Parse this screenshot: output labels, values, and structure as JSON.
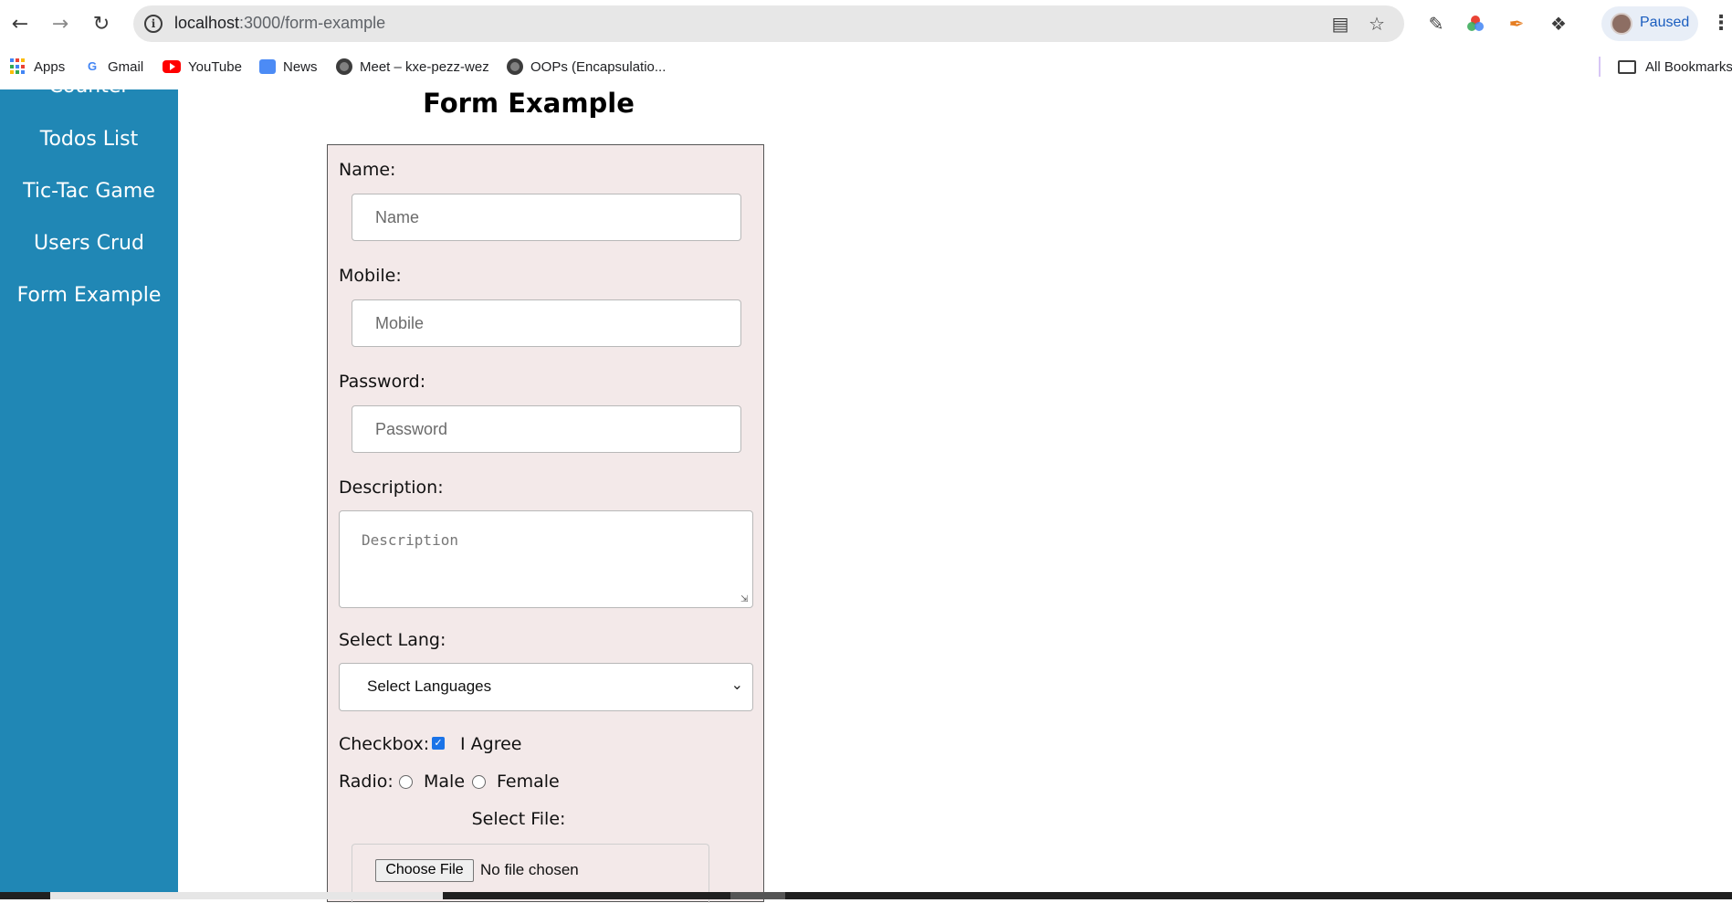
{
  "browser": {
    "url_host": "localhost",
    "url_path": ":3000/form-example",
    "profile_label": "Paused",
    "bookmarks": [
      "Apps",
      "Gmail",
      "YouTube",
      "News",
      "Meet – kxe-pezz-wez",
      "OOPs (Encapsulatio..."
    ],
    "all_bookmarks": "All Bookmarks",
    "gmail_letter": "G"
  },
  "sidebar": {
    "items": [
      "Counter",
      "Todos List",
      "Tic-Tac Game",
      "Users Crud",
      "Form Example"
    ]
  },
  "form": {
    "title": "Form Example",
    "name_label": "Name:",
    "name_placeholder": "Name",
    "mobile_label": "Mobile:",
    "mobile_placeholder": "Mobile",
    "password_label": "Password:",
    "password_placeholder": "Password",
    "description_label": "Description:",
    "description_placeholder": "Description",
    "select_label": "Select Lang:",
    "select_value": "Select Languages",
    "checkbox_label": "Checkbox:",
    "checkbox_text": "I Agree",
    "checkbox_checked": true,
    "radio_label": "Radio:",
    "radio_options": [
      "Male",
      "Female"
    ],
    "file_label": "Select File:",
    "file_button": "Choose File",
    "file_status": "No file chosen"
  },
  "colors": {
    "sidebar_bg": "#2087b5",
    "form_bg": "#f3e9e9",
    "checkbox_accent": "#1a73e8"
  }
}
